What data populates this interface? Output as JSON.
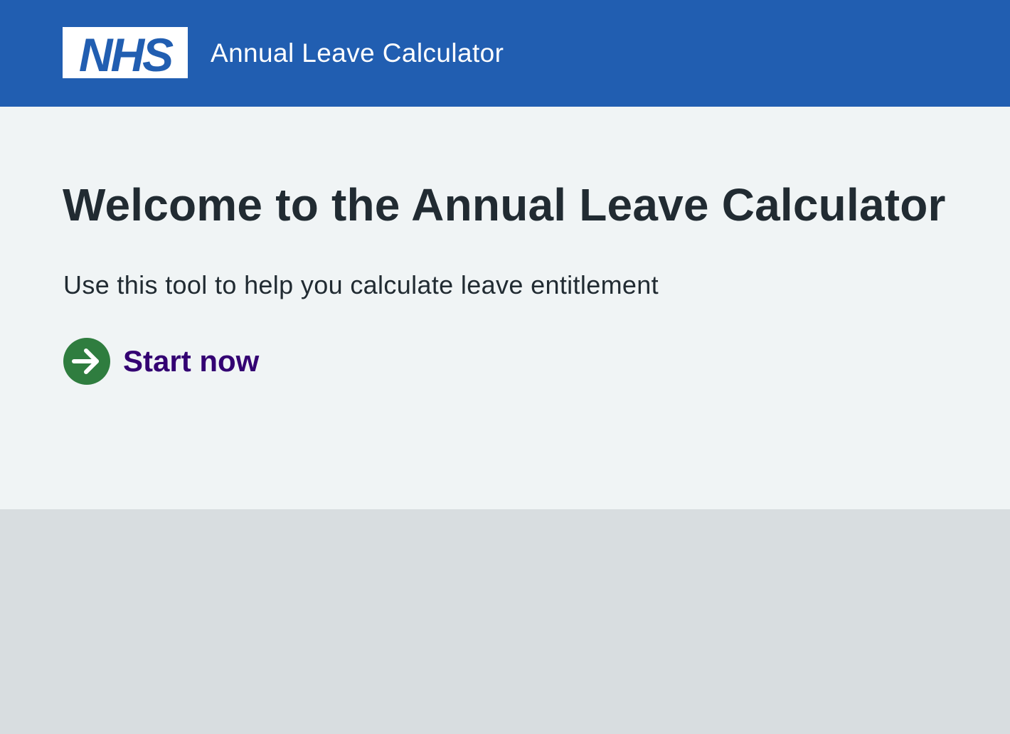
{
  "header": {
    "logo_text": "NHS",
    "service_name": "Annual Leave Calculator"
  },
  "main": {
    "title": "Welcome to the Annual Leave Calculator",
    "lede": "Use this tool to help you calculate leave entitlement",
    "start_link": {
      "label": "Start now",
      "icon": "arrow-right-circle-icon"
    }
  },
  "colors": {
    "header_blue": "#215eb1",
    "page_background": "#f0f4f5",
    "footer_background": "#d8dde0",
    "text": "#212b32",
    "link_purple": "#330072",
    "icon_green": "#2f7d3f"
  }
}
